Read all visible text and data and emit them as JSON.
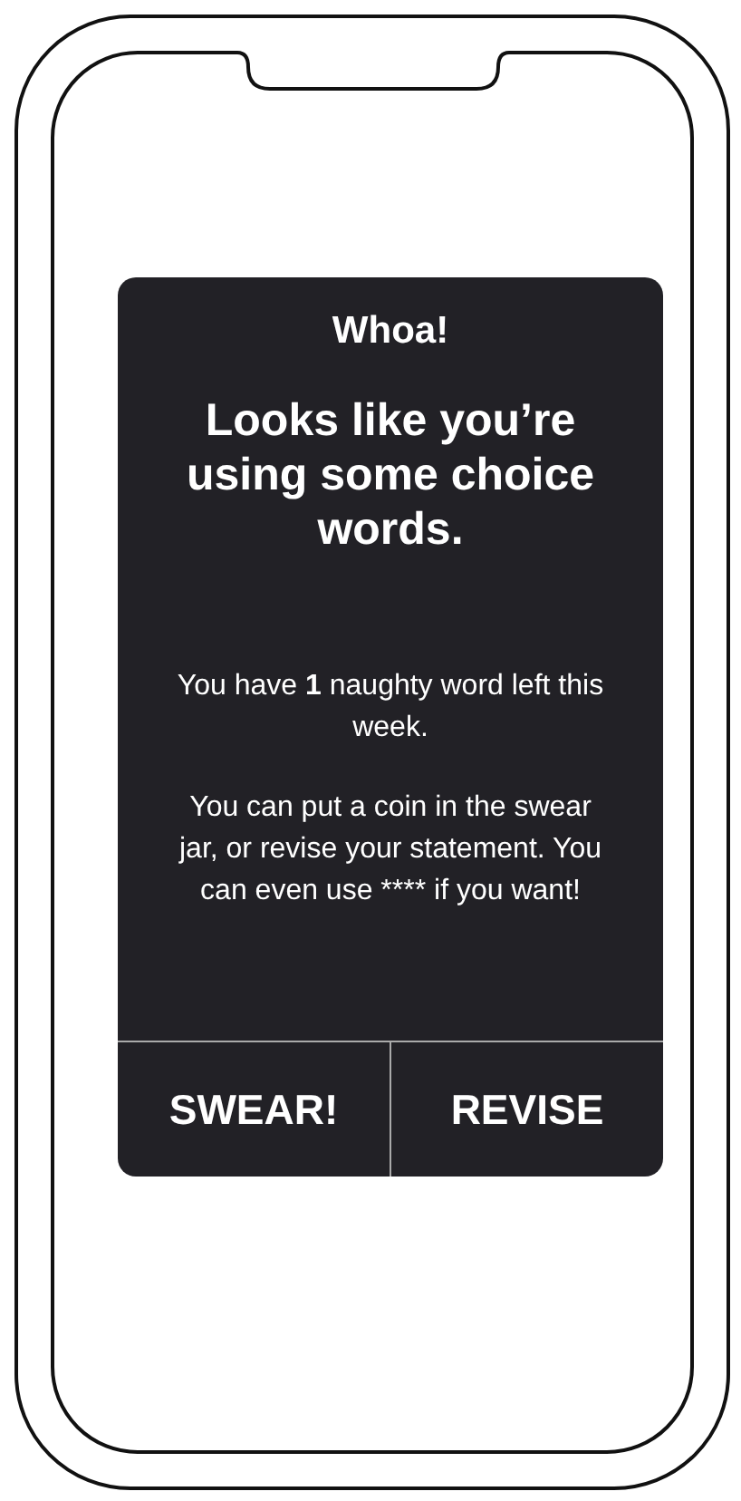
{
  "dialog": {
    "title": "Whoa!",
    "heading": "Looks like you’re using some choice words.",
    "message": "You have **1** naughty word left this week.",
    "note": "You can put a coin in the swear jar, or revise your statement. You can even use **** if you want!",
    "buttons": [
      "SWEAR!",
      "REVISE"
    ]
  }
}
